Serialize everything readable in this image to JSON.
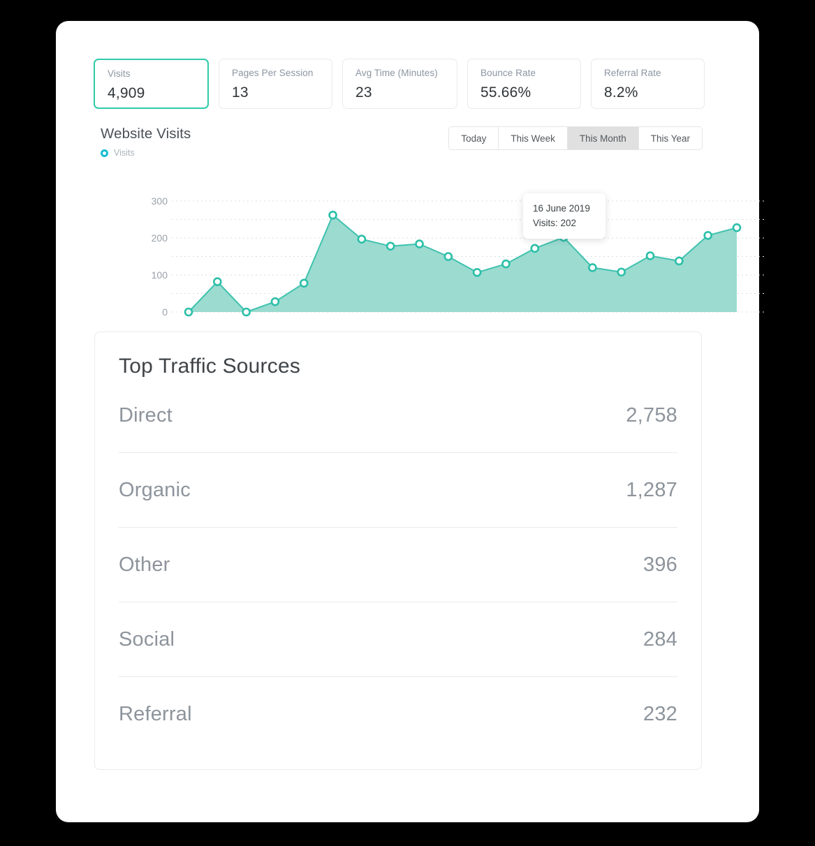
{
  "stats": [
    {
      "label": "Visits",
      "value": "4,909",
      "active": true
    },
    {
      "label": "Pages Per Session",
      "value": "13",
      "active": false
    },
    {
      "label": "Avg Time (Minutes)",
      "value": "23",
      "active": false
    },
    {
      "label": "Bounce Rate",
      "value": "55.66%",
      "active": false
    },
    {
      "label": "Referral Rate",
      "value": "8.2%",
      "active": false
    }
  ],
  "chart_panel": {
    "title": "Website Visits",
    "legend_label": "Visits",
    "tabs": [
      {
        "label": "Today",
        "active": false
      },
      {
        "label": "This Week",
        "active": false
      },
      {
        "label": "This Month",
        "active": true
      },
      {
        "label": "This Year",
        "active": false
      }
    ],
    "tooltip": {
      "date": "16 June 2019",
      "visits": "Visits: 202"
    }
  },
  "chart_data": {
    "type": "area",
    "title": "Website Visits",
    "xlabel": "",
    "ylabel": "",
    "ylim": [
      0,
      300
    ],
    "yticks": [
      0,
      100,
      200,
      300
    ],
    "ytick_labels": [
      "0",
      "100",
      "200",
      "300"
    ],
    "grid": true,
    "legend_position": "top-left",
    "series": [
      {
        "name": "Visits",
        "values": [
          0,
          82,
          0,
          28,
          78,
          262,
          197,
          178,
          184,
          150,
          107,
          130,
          172,
          202,
          120,
          108,
          152,
          138,
          207,
          228
        ]
      }
    ],
    "highlight": {
      "index": 13,
      "label": "16 June 2019",
      "value": 202
    },
    "colors": {
      "line": "#3fc2ae",
      "fill": "#9bdbd0",
      "marker_stroke": "#2bbfa8"
    }
  },
  "traffic_sources": {
    "title": "Top Traffic Sources",
    "rows": [
      {
        "name": "Direct",
        "value": "2,758"
      },
      {
        "name": "Organic",
        "value": "1,287"
      },
      {
        "name": "Other",
        "value": "396"
      },
      {
        "name": "Social",
        "value": "284"
      },
      {
        "name": "Referral",
        "value": "232"
      }
    ]
  },
  "theme": {
    "accent": "#2ecaaa",
    "chart_fill": "#9bdbd0",
    "chart_stroke": "#3fc2ae",
    "legend_marker": "#18bcd4",
    "active_tab_bg": "#e0e0e0"
  }
}
